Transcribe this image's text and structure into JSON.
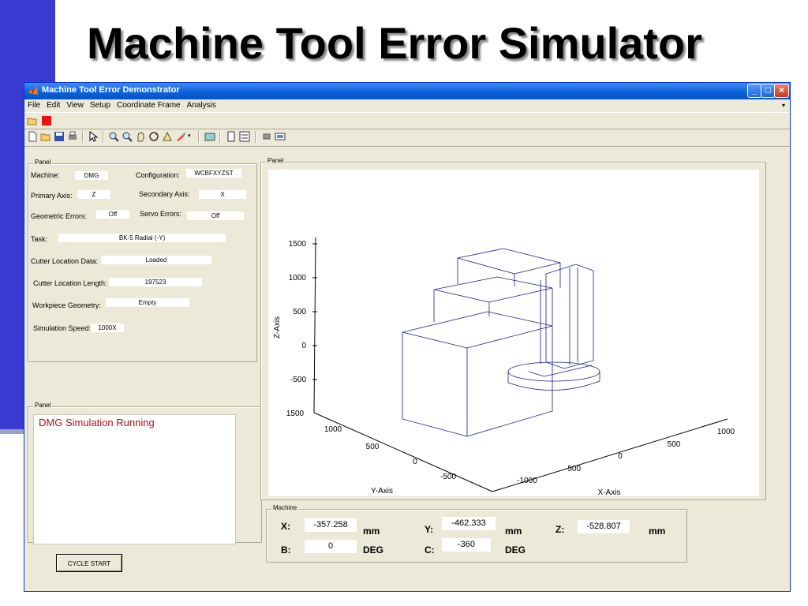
{
  "slide": {
    "title": "Machine Tool Error Simulator"
  },
  "window": {
    "title": "Machine Tool Error Demonstrator"
  },
  "menu": [
    "File",
    "Edit",
    "View",
    "Setup",
    "Coordinate Frame",
    "Analysis"
  ],
  "panel_info": {
    "legend": "Panel",
    "machine_label": "Machine:",
    "machine_value": "DMG",
    "config_label": "Configuration:",
    "config_value": "WCBFXYZST",
    "primary_axis_label": "Primary Axis:",
    "primary_axis_value": "Z",
    "secondary_axis_label": "Secondary Axis:",
    "secondary_axis_value": "X",
    "geometric_errors_label": "Geometric Errors:",
    "geometric_errors_value": "Off",
    "servo_errors_label": "Servo Errors:",
    "servo_errors_value": "Off",
    "task_label": "Task:",
    "task_value": "BK-5 Radial (-Y)",
    "cutter_data_label": "Cutter Location Data:",
    "cutter_data_value": "Loaded",
    "cutter_length_label": "Cutter Location Length:",
    "cutter_length_value": "197523",
    "workpiece_label": "Workpiece Geometry:",
    "workpiece_value": "Empty",
    "speed_label": "Simulation Speed:",
    "speed_value": "1000X"
  },
  "panel_status": {
    "legend": "Panel",
    "message": "DMG Simulation Running"
  },
  "panel_plot": {
    "legend": "Panel",
    "z_axis_label": "Z-Axis",
    "y_axis_label": "Y-Axis",
    "x_axis_label": "X-Axis",
    "z_ticks": [
      "1500",
      "1000",
      "500",
      "0",
      "-500"
    ],
    "y_ticks": [
      "1500",
      "1000",
      "500",
      "0",
      "-500"
    ],
    "x_ticks": [
      "-1000",
      "-500",
      "0",
      "500",
      "1000"
    ]
  },
  "panel_machine": {
    "legend": "Machine",
    "x_label": "X:",
    "x_value": "-357.258",
    "x_unit": "mm",
    "y_label": "Y:",
    "y_value": "-462.333",
    "y_unit": "mm",
    "z_label": "Z:",
    "z_value": "-528.807",
    "z_unit": "mm",
    "b_label": "B:",
    "b_value": "0",
    "b_unit": "DEG",
    "c_label": "C:",
    "c_value": "-360",
    "c_unit": "DEG"
  },
  "buttons": {
    "cycle_start": "CYCLE START"
  },
  "colors": {
    "slide_bar": "#3a3ad0",
    "titlebar": "#0a5fd6",
    "status_text": "#b01010",
    "wireframe": "#1a1a9a"
  }
}
